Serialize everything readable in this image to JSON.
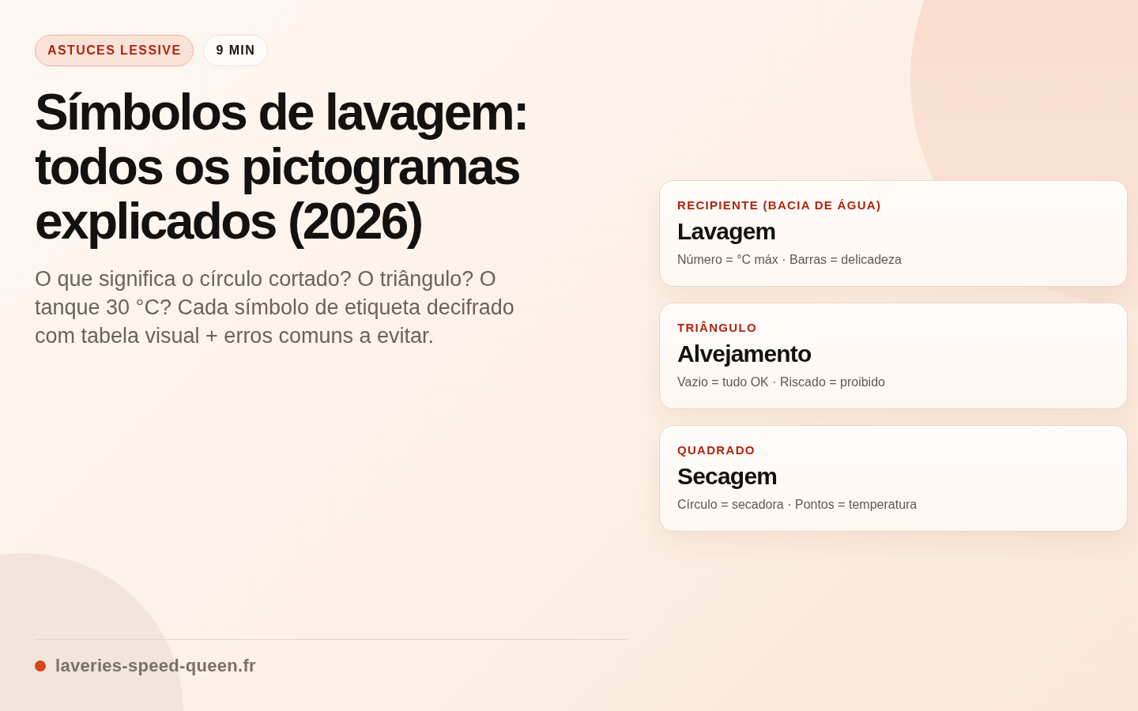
{
  "badges": [
    {
      "kind": "category",
      "label": "ASTUCES LESSIVE"
    },
    {
      "kind": "duration",
      "label": "9 MIN"
    }
  ],
  "title": "Símbolos de lavagem: todos os pictogramas explicados (2026)",
  "subtitle": "O que significa o círculo cortado? O triângulo? O tanque 30 °C? Cada símbolo de etiqueta decifrado com tabela visual + erros comuns a evitar.",
  "cards": [
    {
      "eyebrow": "RECIPIENTE (BACIA DE ÁGUA)",
      "title": "Lavagem",
      "description": "Número = °C máx · Barras = delicadeza"
    },
    {
      "eyebrow": "TRIÂNGULO",
      "title": "Alvejamento",
      "description": "Vazio = tudo OK · Riscado = proibido"
    },
    {
      "eyebrow": "QUADRADO",
      "title": "Secagem",
      "description": "Círculo = secadora · Pontos = temperatura"
    }
  ],
  "footer": {
    "domain": "laveries-speed-queen.fr"
  }
}
